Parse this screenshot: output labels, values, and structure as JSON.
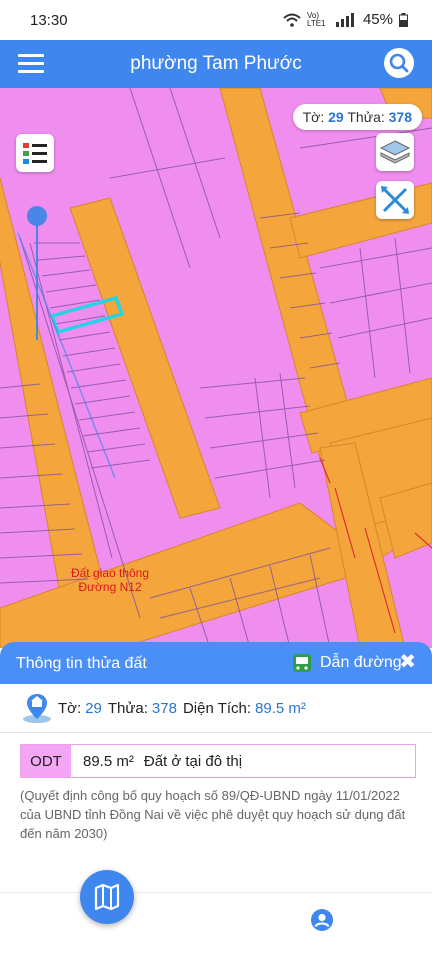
{
  "status_bar": {
    "time": "13:30",
    "network": "Vo) LTE1",
    "battery": "45%"
  },
  "app_bar": {
    "title": "phường Tam Phước"
  },
  "parcel_chip": {
    "sheet_label": "Tờ:",
    "sheet_value": "29",
    "plot_label": "Thửa:",
    "plot_value": "378"
  },
  "map": {
    "label_line1": "Đất giao thông",
    "label_line2": "Đường N12"
  },
  "panel": {
    "title": "Thông tin thửa đất",
    "directions_label": "Dẫn đường",
    "close_symbol": "✖",
    "info": {
      "sheet_label": "Tờ:",
      "sheet_value": "29",
      "plot_label": "Thửa:",
      "plot_value": "378",
      "area_label": "Diện Tích:",
      "area_value": "89.5 m²"
    },
    "land_use": {
      "code": "ODT",
      "area": "89.5 m²",
      "description": "Đất ở tại đô thị"
    },
    "note": "(Quyết định công bố quy hoạch số 89/QĐ-UBND ngày 11/01/2022 của UBND tỉnh Đồng Nai về việc phê duyệt quy hoạch sử dụng đất đến năm 2030)"
  },
  "icons": [
    "menu-icon",
    "search-icon",
    "legend-icon",
    "layers-icon",
    "measure-icon",
    "location-pin-icon",
    "bus-icon",
    "map-icon",
    "user-icon",
    "wifi-icon",
    "battery-icon"
  ],
  "colors": {
    "primary": "#3f86ef",
    "panel_header": "#4a8ff5",
    "residential_land": "#f08ef0",
    "road": "#f4a63c",
    "value_blue": "#2a76d2",
    "selected_parcel": "#24d4e6"
  }
}
